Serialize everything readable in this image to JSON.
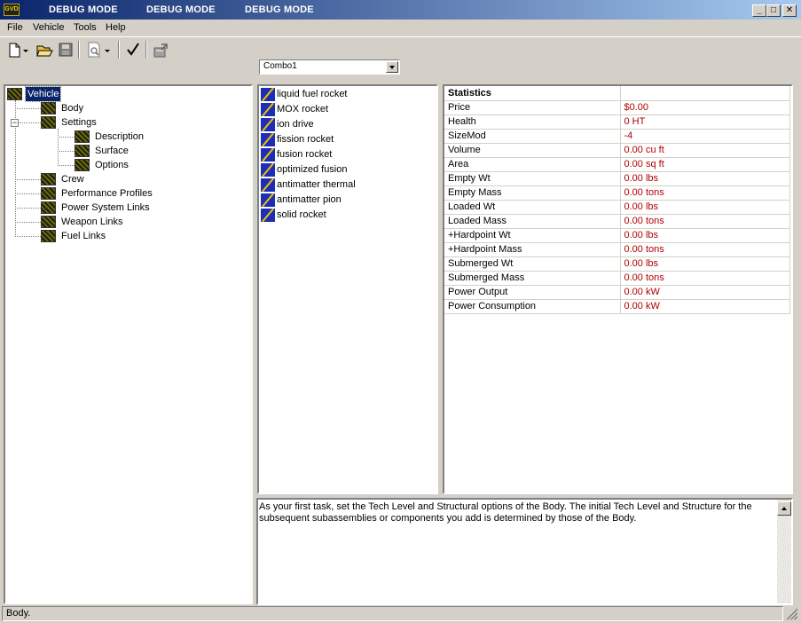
{
  "titlebar": {
    "icon_text": "GVD",
    "titles": [
      "DEBUG MODE",
      "DEBUG MODE",
      "DEBUG MODE"
    ]
  },
  "menu": [
    "File",
    "Vehicle",
    "Tools",
    "Help"
  ],
  "toolbar": {
    "icons": [
      "new-icon",
      "dropdown-arrow-icon",
      "open-folder-icon",
      "save-icon",
      "print-preview-icon",
      "dropdown-arrow-icon",
      "checkmark-icon",
      "export-icon"
    ]
  },
  "combo": {
    "value": "Combo1"
  },
  "tree": {
    "root": "Vehicle",
    "body": "Body",
    "settings": "Settings",
    "description": "Description",
    "surface": "Surface",
    "options": "Options",
    "crew": "Crew",
    "performance": "Performance Profiles",
    "power_links": "Power System Links",
    "weapon_links": "Weapon Links",
    "fuel_links": "Fuel Links"
  },
  "components": [
    "liquid fuel rocket",
    "MOX rocket",
    "ion drive",
    "fission rocket",
    "fusion rocket",
    "optimized fusion",
    "antimatter thermal",
    "antimatter pion",
    "solid rocket"
  ],
  "stats": {
    "header": "Statistics",
    "rows": [
      {
        "k": "Price",
        "v": "$0.00"
      },
      {
        "k": "Health",
        "v": "0 HT"
      },
      {
        "k": "SizeMod",
        "v": "-4"
      },
      {
        "k": "Volume",
        "v": "0.00 cu ft"
      },
      {
        "k": "Area",
        "v": "0.00 sq ft"
      },
      {
        "k": "Empty Wt",
        "v": "0.00 lbs"
      },
      {
        "k": "Empty Mass",
        "v": "0.00 tons"
      },
      {
        "k": "Loaded Wt",
        "v": "0.00 lbs"
      },
      {
        "k": "Loaded Mass",
        "v": "0.00 tons"
      },
      {
        "k": "+Hardpoint Wt",
        "v": "0.00 lbs"
      },
      {
        "k": "+Hardpoint Mass",
        "v": "0.00 tons"
      },
      {
        "k": "Submerged Wt",
        "v": "0.00 lbs"
      },
      {
        "k": "Submerged Mass",
        "v": "0.00 tons"
      },
      {
        "k": "Power Output",
        "v": "0.00 kW"
      },
      {
        "k": "Power Consumption",
        "v": "0.00 kW"
      }
    ]
  },
  "help_text": "As your first task, set the Tech Level and Structural options of the Body.  The initial Tech Level and Structure for the subsequent subassemblies or components you add is determined by those of the Body.",
  "status": "Body.",
  "colors": {
    "title_start": "#0a246a",
    "title_end": "#a6caf0",
    "value_red": "#b00000",
    "selection": "#0a246a",
    "chrome": "#d4d0c8"
  }
}
